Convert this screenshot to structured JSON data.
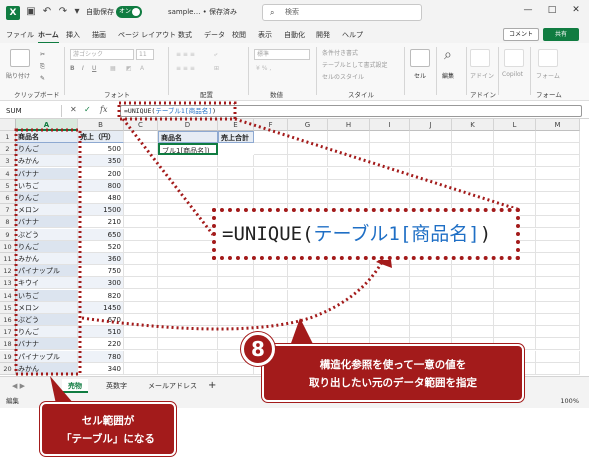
{
  "titlebar": {
    "logo": "X",
    "autosave_label": "自動保存",
    "autosave_state": "オン",
    "filename": "sample… • 保存済み",
    "search_placeholder": "検索",
    "minimize": "—",
    "maximize": "□",
    "close": "✕"
  },
  "menu": {
    "tabs": [
      "ファイル",
      "ホーム",
      "挿入",
      "描画",
      "ページ レイアウト",
      "数式",
      "データ",
      "校閲",
      "表示",
      "自動化",
      "開発",
      "ヘルプ"
    ],
    "active": "ホーム",
    "comment": "コメント",
    "share": "共有"
  },
  "ribbon": {
    "groups": [
      "クリップボード",
      "フォント",
      "配置",
      "数値",
      "スタイル",
      "セル",
      "編集",
      "アドイン",
      "フォーム"
    ],
    "paste": "貼り付け",
    "font_name": "游ゴシック",
    "font_size": "11",
    "number_format": "標準",
    "style_items": [
      "条件付き書式",
      "テーブルとして書式設定",
      "セルのスタイル"
    ],
    "cells": "セル",
    "edit": "編集",
    "addin": "アドイン",
    "copilot": "Copilot",
    "form": "フォーム"
  },
  "formula_bar": {
    "name_box": "SUM",
    "fx": "fx",
    "formula_prefix": "=UNIQUE(",
    "formula_ref": "テーブル1[商品名]",
    "formula_suffix": ")"
  },
  "grid": {
    "columns": [
      "A",
      "B",
      "C",
      "D",
      "E",
      "F",
      "G",
      "H",
      "I",
      "J",
      "K",
      "L",
      "M"
    ],
    "header_row": {
      "a": "商品名",
      "b": "売上（円）",
      "d": "商品名",
      "e": "売上合計"
    },
    "d2": "ブル1[商品名])",
    "rows": [
      {
        "name": "りんご",
        "amount": "500"
      },
      {
        "name": "みかん",
        "amount": "350"
      },
      {
        "name": "バナナ",
        "amount": "200"
      },
      {
        "name": "いちご",
        "amount": "800"
      },
      {
        "name": "りんご",
        "amount": "480"
      },
      {
        "name": "メロン",
        "amount": "1500"
      },
      {
        "name": "バナナ",
        "amount": "210"
      },
      {
        "name": "ぶどう",
        "amount": "650"
      },
      {
        "name": "りんご",
        "amount": "520"
      },
      {
        "name": "みかん",
        "amount": "360"
      },
      {
        "name": "パイナップル",
        "amount": "750"
      },
      {
        "name": "キウイ",
        "amount": "300"
      },
      {
        "name": "いちご",
        "amount": "820"
      },
      {
        "name": "メロン",
        "amount": "1450"
      },
      {
        "name": "ぶどう",
        "amount": "670"
      },
      {
        "name": "りんご",
        "amount": "510"
      },
      {
        "name": "バナナ",
        "amount": "220"
      },
      {
        "name": "パイナップル",
        "amount": "780"
      },
      {
        "name": "みかん",
        "amount": "340"
      }
    ]
  },
  "sheets": {
    "tabs": [
      "売物",
      "英数字",
      "メールアドレス"
    ],
    "add": "+"
  },
  "status": {
    "mode": "編集",
    "zoom": "100%"
  },
  "callouts": {
    "zoom_prefix": "=UNIQUE(",
    "zoom_ref": "テーブル1[商品名]",
    "zoom_suffix": ")",
    "step_number": "8",
    "step_text_line1": "構造化参照を使って一意の値を",
    "step_text_line2": "取り出したい元のデータ範囲を指定",
    "table_text_line1": "セル範囲が",
    "table_text_line2": "「テーブル」になる"
  },
  "colors": {
    "excel_green": "#107c41",
    "callout_red": "#a31b1b",
    "ref_blue": "#1f6fc5"
  }
}
